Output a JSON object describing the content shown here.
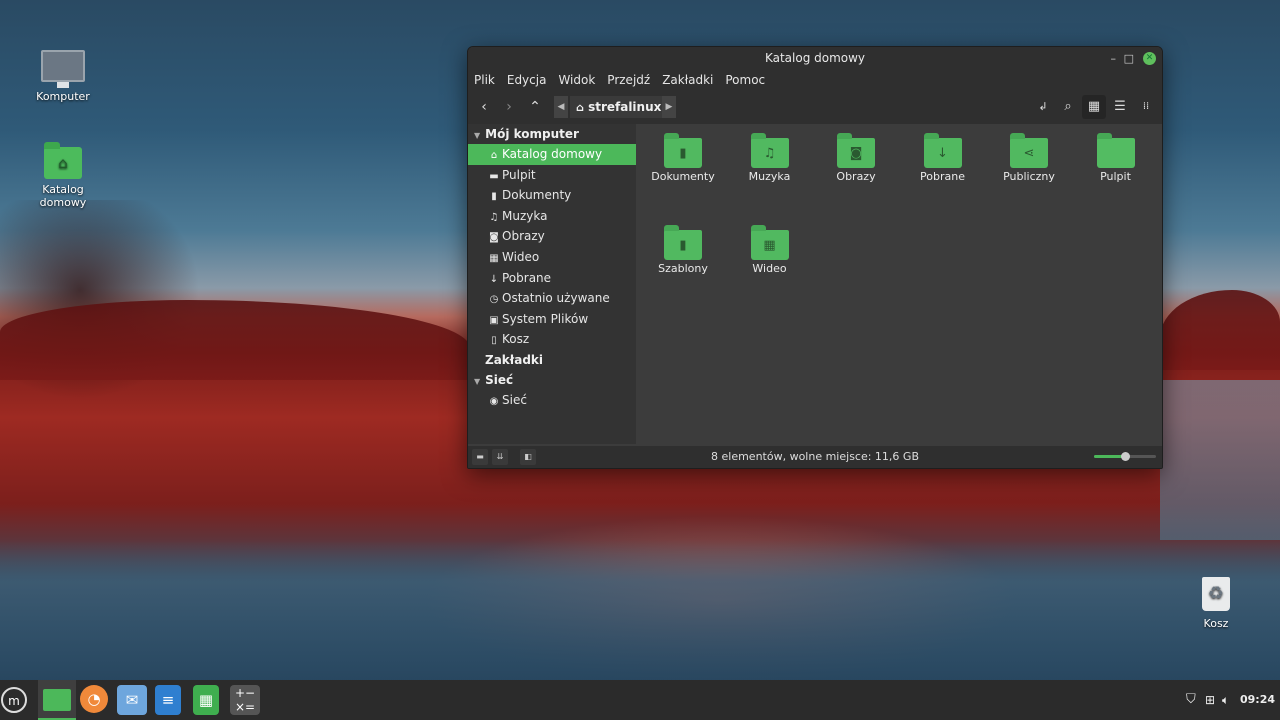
{
  "desktop": {
    "icons": [
      {
        "label": "Komputer"
      },
      {
        "label": "Katalog domowy"
      },
      {
        "label": "Kosz"
      }
    ]
  },
  "window": {
    "title": "Katalog domowy",
    "controls": {
      "minimize": "–",
      "maximize": "□",
      "close": "✕"
    },
    "menu": [
      "Plik",
      "Edycja",
      "Widok",
      "Przejdź",
      "Zakładki",
      "Pomoc"
    ],
    "toolbar": {
      "back": "‹",
      "forward": "›",
      "up": "⌃",
      "breadcrumb": "strefalinux",
      "breadcrumb_icon": "home-icon"
    },
    "sidebar": {
      "my_computer": "Mój komputer",
      "items": [
        {
          "label": "Katalog domowy",
          "icon": "home-icon",
          "glyph": "⌂",
          "selected": true
        },
        {
          "label": "Pulpit",
          "icon": "desktop-icon",
          "glyph": "▬"
        },
        {
          "label": "Dokumenty",
          "icon": "document-icon",
          "glyph": "▮"
        },
        {
          "label": "Muzyka",
          "icon": "music-icon",
          "glyph": "♫"
        },
        {
          "label": "Obrazy",
          "icon": "camera-icon",
          "glyph": "◙"
        },
        {
          "label": "Wideo",
          "icon": "film-icon",
          "glyph": "▦"
        },
        {
          "label": "Pobrane",
          "icon": "download-icon",
          "glyph": "↓"
        },
        {
          "label": "Ostatnio używane",
          "icon": "clock-icon",
          "glyph": "◷"
        },
        {
          "label": "System Plików",
          "icon": "drive-icon",
          "glyph": "▣"
        },
        {
          "label": "Kosz",
          "icon": "trash-icon",
          "glyph": "▯"
        }
      ],
      "bookmarks": "Zakładki",
      "network": "Sieć",
      "network_items": [
        {
          "label": "Sieć",
          "icon": "globe-icon",
          "glyph": "◉"
        }
      ]
    },
    "files": [
      {
        "label": "Dokumenty",
        "icon": "document-folder-icon",
        "glyph": "▮"
      },
      {
        "label": "Muzyka",
        "icon": "music-folder-icon",
        "glyph": "♫"
      },
      {
        "label": "Obrazy",
        "icon": "camera-folder-icon",
        "glyph": "◙"
      },
      {
        "label": "Pobrane",
        "icon": "download-folder-icon",
        "glyph": "↓"
      },
      {
        "label": "Publiczny",
        "icon": "share-folder-icon",
        "glyph": "⋖"
      },
      {
        "label": "Pulpit",
        "icon": "plain-folder-icon",
        "glyph": ""
      },
      {
        "label": "Szablony",
        "icon": "template-folder-icon",
        "glyph": "▮"
      },
      {
        "label": "Wideo",
        "icon": "film-folder-icon",
        "glyph": "▦"
      }
    ],
    "status": "8 elementów, wolne miejsce: 11,6 GB",
    "zoom_level": 0.5
  },
  "taskbar": {
    "clock": "09:24",
    "apps": [
      {
        "name": "menu-button",
        "glyph": "◎"
      },
      {
        "name": "files-app",
        "glyph": ""
      },
      {
        "name": "firefox-app",
        "glyph": "◔"
      },
      {
        "name": "mail-app",
        "glyph": "✉"
      },
      {
        "name": "writer-app",
        "glyph": "≡"
      },
      {
        "name": "calc-app",
        "glyph": "▦"
      },
      {
        "name": "calculator-app",
        "glyph": "±"
      }
    ]
  },
  "colors": {
    "accent": "#4cb85a",
    "window_bg": "#3c3c3c",
    "sidebar_bg": "#333333"
  }
}
